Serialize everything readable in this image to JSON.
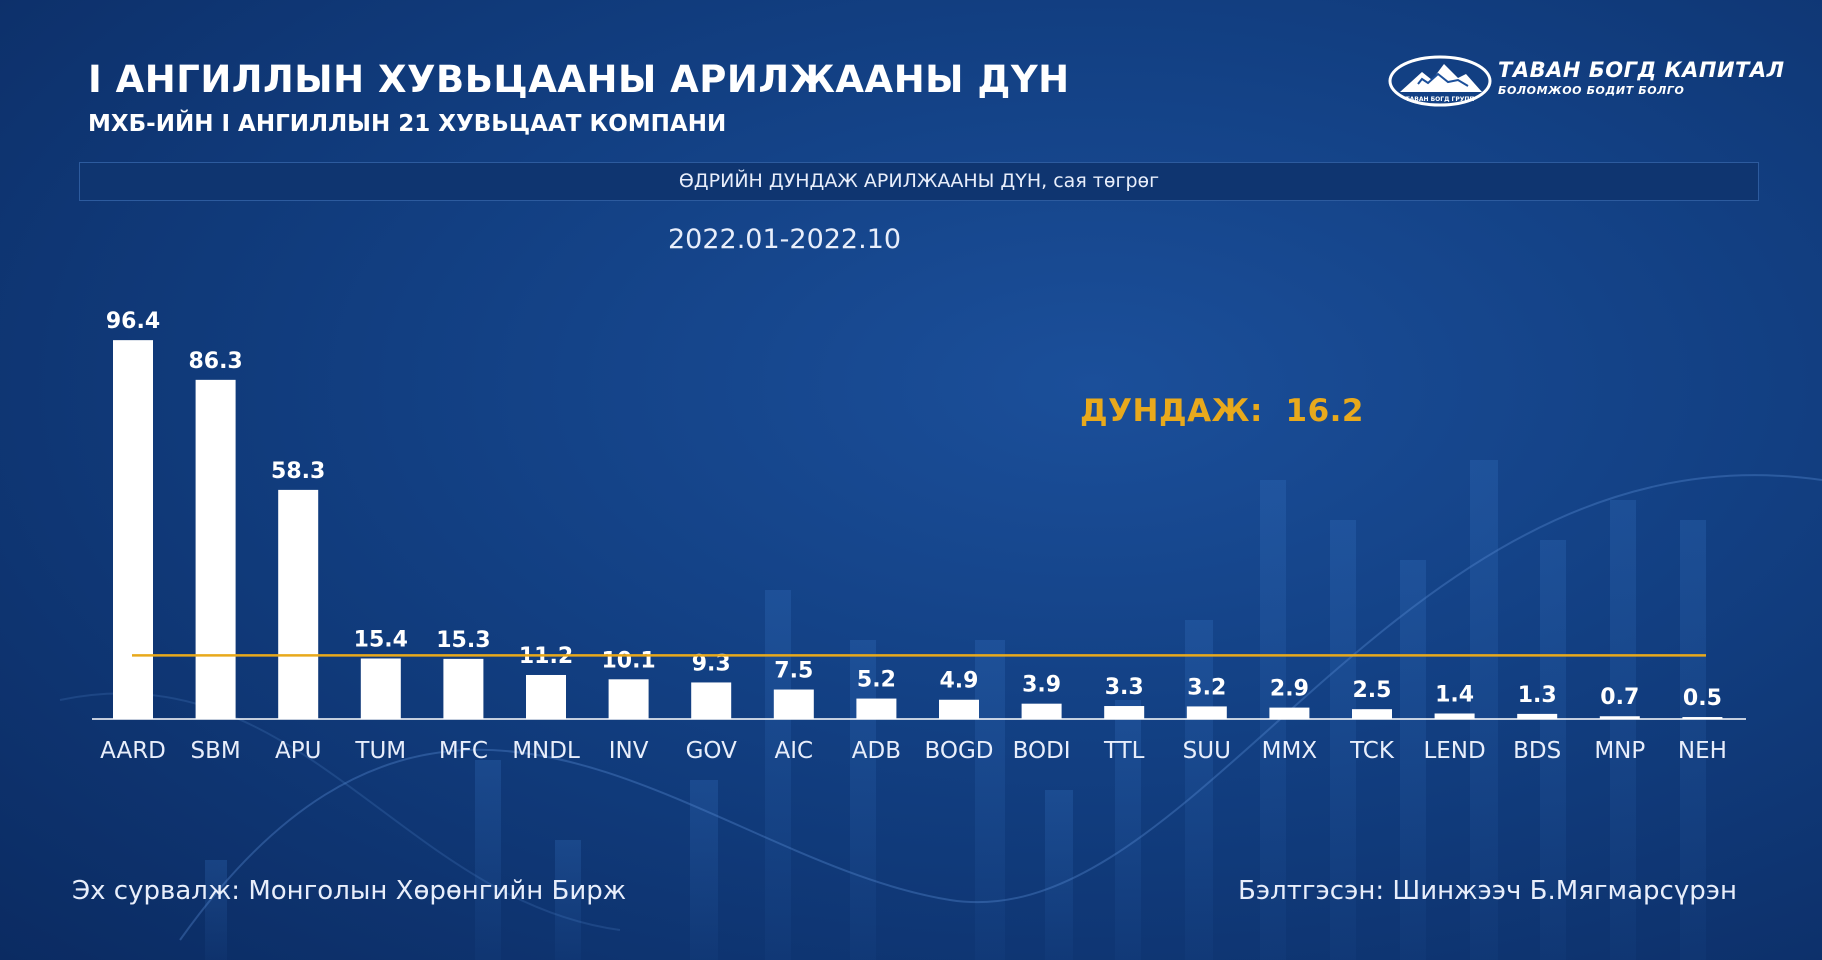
{
  "header": {
    "title": "I АНГИЛЛЫН ХУВЬЦААНЫ АРИЛЖААНЫ ДҮН",
    "subtitle": "МХБ-ИЙН I АНГИЛЛЫН 21 ХУВЬЦААТ КОМПАНИ"
  },
  "logo": {
    "name": "ТАВАН БОГД КАПИТАЛ",
    "tagline": "БОЛОМЖОО БОДИТ БОЛГО",
    "emblem_text": "ТАВАН БОГД ГРУПП"
  },
  "banner": {
    "text": "ӨДРИЙН ДУНДАЖ АРИЛЖААНЫ ДҮН, сая төгрөг"
  },
  "period": "2022.01-2022.10",
  "average": {
    "label": "ДУНДАЖ:",
    "value": "16.2"
  },
  "footer": {
    "source": "Эх сурвалж: Монголын Хөрөнгийн Бирж",
    "author": "Бэлтгэсэн: Шинжээч Б.Мягмарсүрэн"
  },
  "colors": {
    "bar": "#ffffff",
    "average_line": "#e8a91c",
    "average_text": "#e8a91c",
    "background": "#123f82"
  },
  "chart_data": {
    "type": "bar",
    "categories": [
      "AARD",
      "SBM",
      "APU",
      "TUM",
      "MFC",
      "MNDL",
      "INV",
      "GOV",
      "AIC",
      "ADB",
      "BOGD",
      "BODI",
      "TTL",
      "SUU",
      "MMX",
      "TCK",
      "LEND",
      "BDS",
      "MNP",
      "NEH"
    ],
    "values": [
      96.4,
      86.3,
      58.3,
      15.4,
      15.3,
      11.2,
      10.1,
      9.3,
      7.5,
      5.2,
      4.9,
      3.9,
      3.3,
      3.2,
      2.9,
      2.5,
      1.4,
      1.3,
      0.7,
      0.5
    ],
    "value_labels": [
      "96.4",
      "86.3",
      "58.3",
      "15.4",
      "15.3",
      "11.2",
      "10.1",
      "9.3",
      "7.5",
      "5.2",
      "4.9",
      "3.9",
      "3.3",
      "3.2",
      "2.9",
      "2.5",
      "1.4",
      "1.3",
      "0.7",
      "0.5"
    ],
    "average": 16.2,
    "ylim": [
      0,
      100
    ],
    "title": "ӨДРИЙН ДУНДАЖ АРИЛЖААНЫ ДҮН, сая төгрөг",
    "grid": false,
    "legend": "none"
  }
}
